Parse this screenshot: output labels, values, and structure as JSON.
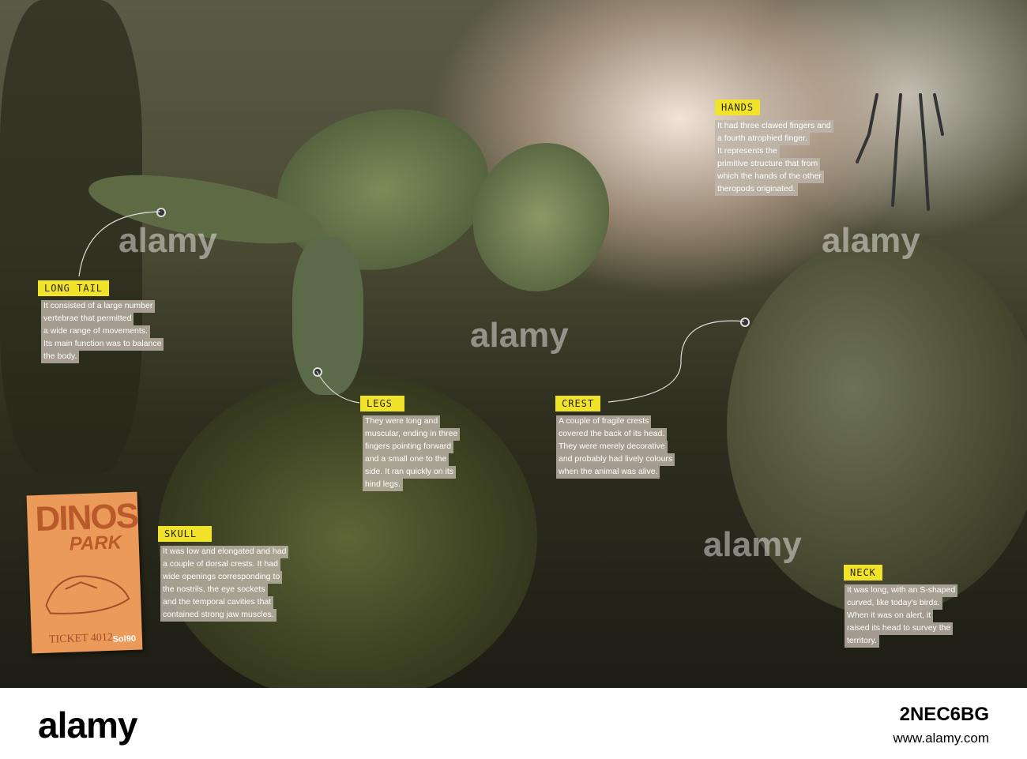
{
  "callouts": {
    "long_tail": {
      "title": "LONG TAIL",
      "lines": [
        "It consisted of a large number",
        "vertebrae that permitted",
        "a wide range of movements.",
        "Its main function was to balance",
        "the body."
      ]
    },
    "hands": {
      "title": "HANDS",
      "lines": [
        "It had three clawed fingers and",
        "a fourth atrophied finger.",
        "It represents the",
        "primitive structure that from",
        "which the hands of the other",
        "theropods originated."
      ]
    },
    "legs": {
      "title": "LEGS",
      "lines": [
        "They were long and",
        "muscular, ending in three",
        "fingers pointing forward",
        "and a small one to the",
        "side. It ran quickly on its",
        "hind legs."
      ]
    },
    "crest": {
      "title": "CREST",
      "lines": [
        "A couple of fragile crests",
        "covered the back of its head.",
        "They were merely decorative",
        "and probably had lively colours",
        "when the animal was alive."
      ]
    },
    "skull": {
      "title": "SKULL",
      "lines": [
        "It was low and elongated and had",
        "a couple of dorsal crests. It had",
        "wide openings corresponding to",
        "the nostrils, the eye sockets",
        "and the temporal cavities that",
        "contained strong jaw muscles."
      ]
    },
    "neck": {
      "title": "NECK",
      "lines": [
        "It was long, with an S-shaped",
        "curved, like today's birds.",
        "When it was on alert, it",
        "raised its head to survey the",
        "territory."
      ]
    }
  },
  "ticket": {
    "title": "DINOS",
    "subtitle": "PARK",
    "number": "TICKET 4012",
    "brand": "Sol90"
  },
  "watermark": {
    "text": "alamy",
    "short": "a"
  },
  "footer": {
    "logo": "alamy",
    "image_id": "2NEC6BG",
    "url": "www.alamy.com"
  }
}
